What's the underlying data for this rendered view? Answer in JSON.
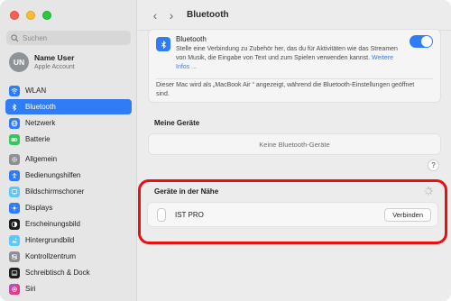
{
  "sidebar": {
    "search_placeholder": "Suchen",
    "account": {
      "initials": "UN",
      "name": "Name User",
      "subtitle": "Apple Account"
    },
    "group1": [
      {
        "label": "WLAN",
        "icon": "wifi-icon",
        "color": "#2f7cf6",
        "active": false
      },
      {
        "label": "Bluetooth",
        "icon": "bluetooth-icon",
        "color": "#2f7cf6",
        "active": true
      },
      {
        "label": "Netzwerk",
        "icon": "globe-icon",
        "color": "#2f7cf6",
        "active": false
      },
      {
        "label": "Batterie",
        "icon": "battery-icon",
        "color": "#34c759",
        "active": false
      }
    ],
    "group2": [
      {
        "label": "Allgemein",
        "icon": "gear-icon",
        "color": "#8e8e93"
      },
      {
        "label": "Bedienungshilfen",
        "icon": "accessibility-icon",
        "color": "#2f7cf6"
      },
      {
        "label": "Bildschirmschoner",
        "icon": "screensaver-icon",
        "color": "#5ac8fa"
      },
      {
        "label": "Displays",
        "icon": "sun-icon",
        "color": "#2f7cf6"
      },
      {
        "label": "Erscheinungsbild",
        "icon": "appearance-icon",
        "color": "#1d1d1d"
      },
      {
        "label": "Hintergrundbild",
        "icon": "wallpaper-icon",
        "color": "#5ac8fa"
      },
      {
        "label": "Kontrollzentrum",
        "icon": "control-center-icon",
        "color": "#8e8e93"
      },
      {
        "label": "Schreibtisch & Dock",
        "icon": "dock-icon",
        "color": "#1d1d1d"
      },
      {
        "label": "Siri",
        "icon": "siri-icon",
        "color": "#af52de"
      }
    ]
  },
  "main": {
    "title": "Bluetooth",
    "bluetooth": {
      "title": "Bluetooth",
      "description": "Stelle eine Verbindung zu Zubehör her, das du für Aktivitäten wie das Streamen von Musik, die Eingabe von Text und zum Spielen verwenden kannst.",
      "link": "Weitere Infos ...",
      "enabled": true,
      "note": "Dieser Mac wird als „MacBook Air “ angezeigt, während die Bluetooth-Einstellungen geöffnet sind."
    },
    "my_devices": {
      "header": "Meine Geräte",
      "empty": "Keine Bluetooth-Geräte"
    },
    "help": "?",
    "nearby": {
      "header": "Geräte in der Nähe",
      "device": {
        "name": "IST PRO",
        "button": "Verbinden"
      }
    }
  },
  "colors": {
    "accent": "#2f7cf6",
    "highlight": "#e81010"
  }
}
